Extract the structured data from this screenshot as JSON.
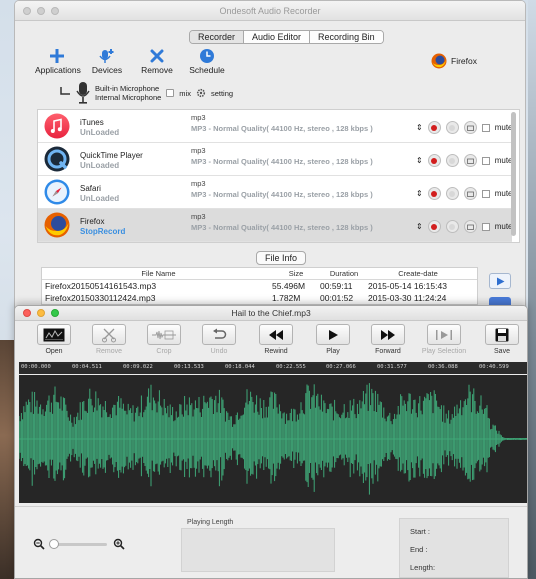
{
  "app": {
    "window_title": "Ondesoft Audio Recorder"
  },
  "tabs": [
    {
      "label": "Recorder",
      "active": true
    },
    {
      "label": "Audio Editor",
      "active": false
    },
    {
      "label": "Recording Bin",
      "active": false
    }
  ],
  "toolbar": {
    "applications": "Applications",
    "devices": "Devices",
    "remove": "Remove",
    "schedule": "Schedule",
    "current_app": "Firefox"
  },
  "microphone": {
    "builtin": "Built-in Microphone",
    "internal": "Internal Microphone",
    "mix": "mix",
    "setting": "setting"
  },
  "sources": [
    {
      "name": "iTunes",
      "state": "UnLoaded",
      "format": "mp3",
      "quality": "MP3 - Normal Quality( 44100 Hz, stereo , 128 kbps )",
      "mute": "mute",
      "selected": false,
      "icon": "itunes-icon"
    },
    {
      "name": "QuickTime Player",
      "state": "UnLoaded",
      "format": "mp3",
      "quality": "MP3 - Normal Quality( 44100 Hz, stereo , 128 kbps )",
      "mute": "mute",
      "selected": false,
      "icon": "quicktime-icon"
    },
    {
      "name": "Safari",
      "state": "UnLoaded",
      "format": "mp3",
      "quality": "MP3 - Normal Quality( 44100 Hz, stereo , 128 kbps )",
      "mute": "mute",
      "selected": false,
      "icon": "safari-icon"
    },
    {
      "name": "Firefox",
      "state": "StopRecord",
      "format": "mp3",
      "quality": "MP3 - Normal Quality( 44100 Hz, stereo , 128 kbps )",
      "mute": "mute",
      "selected": true,
      "icon": "firefox-icon"
    }
  ],
  "file_info": {
    "button": "File Info",
    "headers": [
      "File Name",
      "Size",
      "Duration",
      "Create-date"
    ],
    "rows": [
      [
        "Firefox20150514161543.mp3",
        "55.496M",
        "00:59:11",
        "2015-05-14 16:15:43"
      ],
      [
        "Firefox20150330112424.mp3",
        "1.782M",
        "00:01:52",
        "2015-03-30 11:24:24"
      ]
    ]
  },
  "editor": {
    "title": "Hail to the Chief.mp3",
    "tools": [
      {
        "label": "Open",
        "enabled": true,
        "icon": "open-icon"
      },
      {
        "label": "Remove",
        "enabled": false,
        "icon": "scissors-icon"
      },
      {
        "label": "Crop",
        "enabled": false,
        "icon": "crop-icon"
      },
      {
        "label": "Undo",
        "enabled": false,
        "icon": "undo-icon"
      },
      {
        "label": "Rewind",
        "enabled": true,
        "icon": "rewind-icon"
      },
      {
        "label": "Play",
        "enabled": true,
        "icon": "play-icon"
      },
      {
        "label": "Forward",
        "enabled": true,
        "icon": "forward-icon"
      },
      {
        "label": "Play Selection",
        "enabled": false,
        "icon": "play-selection-icon"
      },
      {
        "label": "Save",
        "enabled": true,
        "icon": "save-icon"
      }
    ],
    "timeline": [
      "00:00.000",
      "00:04.511",
      "00:09.022",
      "00:13.533",
      "00:18.044",
      "00:22.555",
      "00:27.066",
      "00:31.577",
      "00:36.088",
      "00:40.599"
    ],
    "playing_length_label": "Playing Length",
    "start_label": "Start  :",
    "end_label": "End  :",
    "length_label": "Length:",
    "wave_color": "#3fa878",
    "zoom_level": 0
  },
  "colors": {
    "accent": "#4a7bd8",
    "record": "#d21e1e",
    "wave": "#3fa878"
  }
}
